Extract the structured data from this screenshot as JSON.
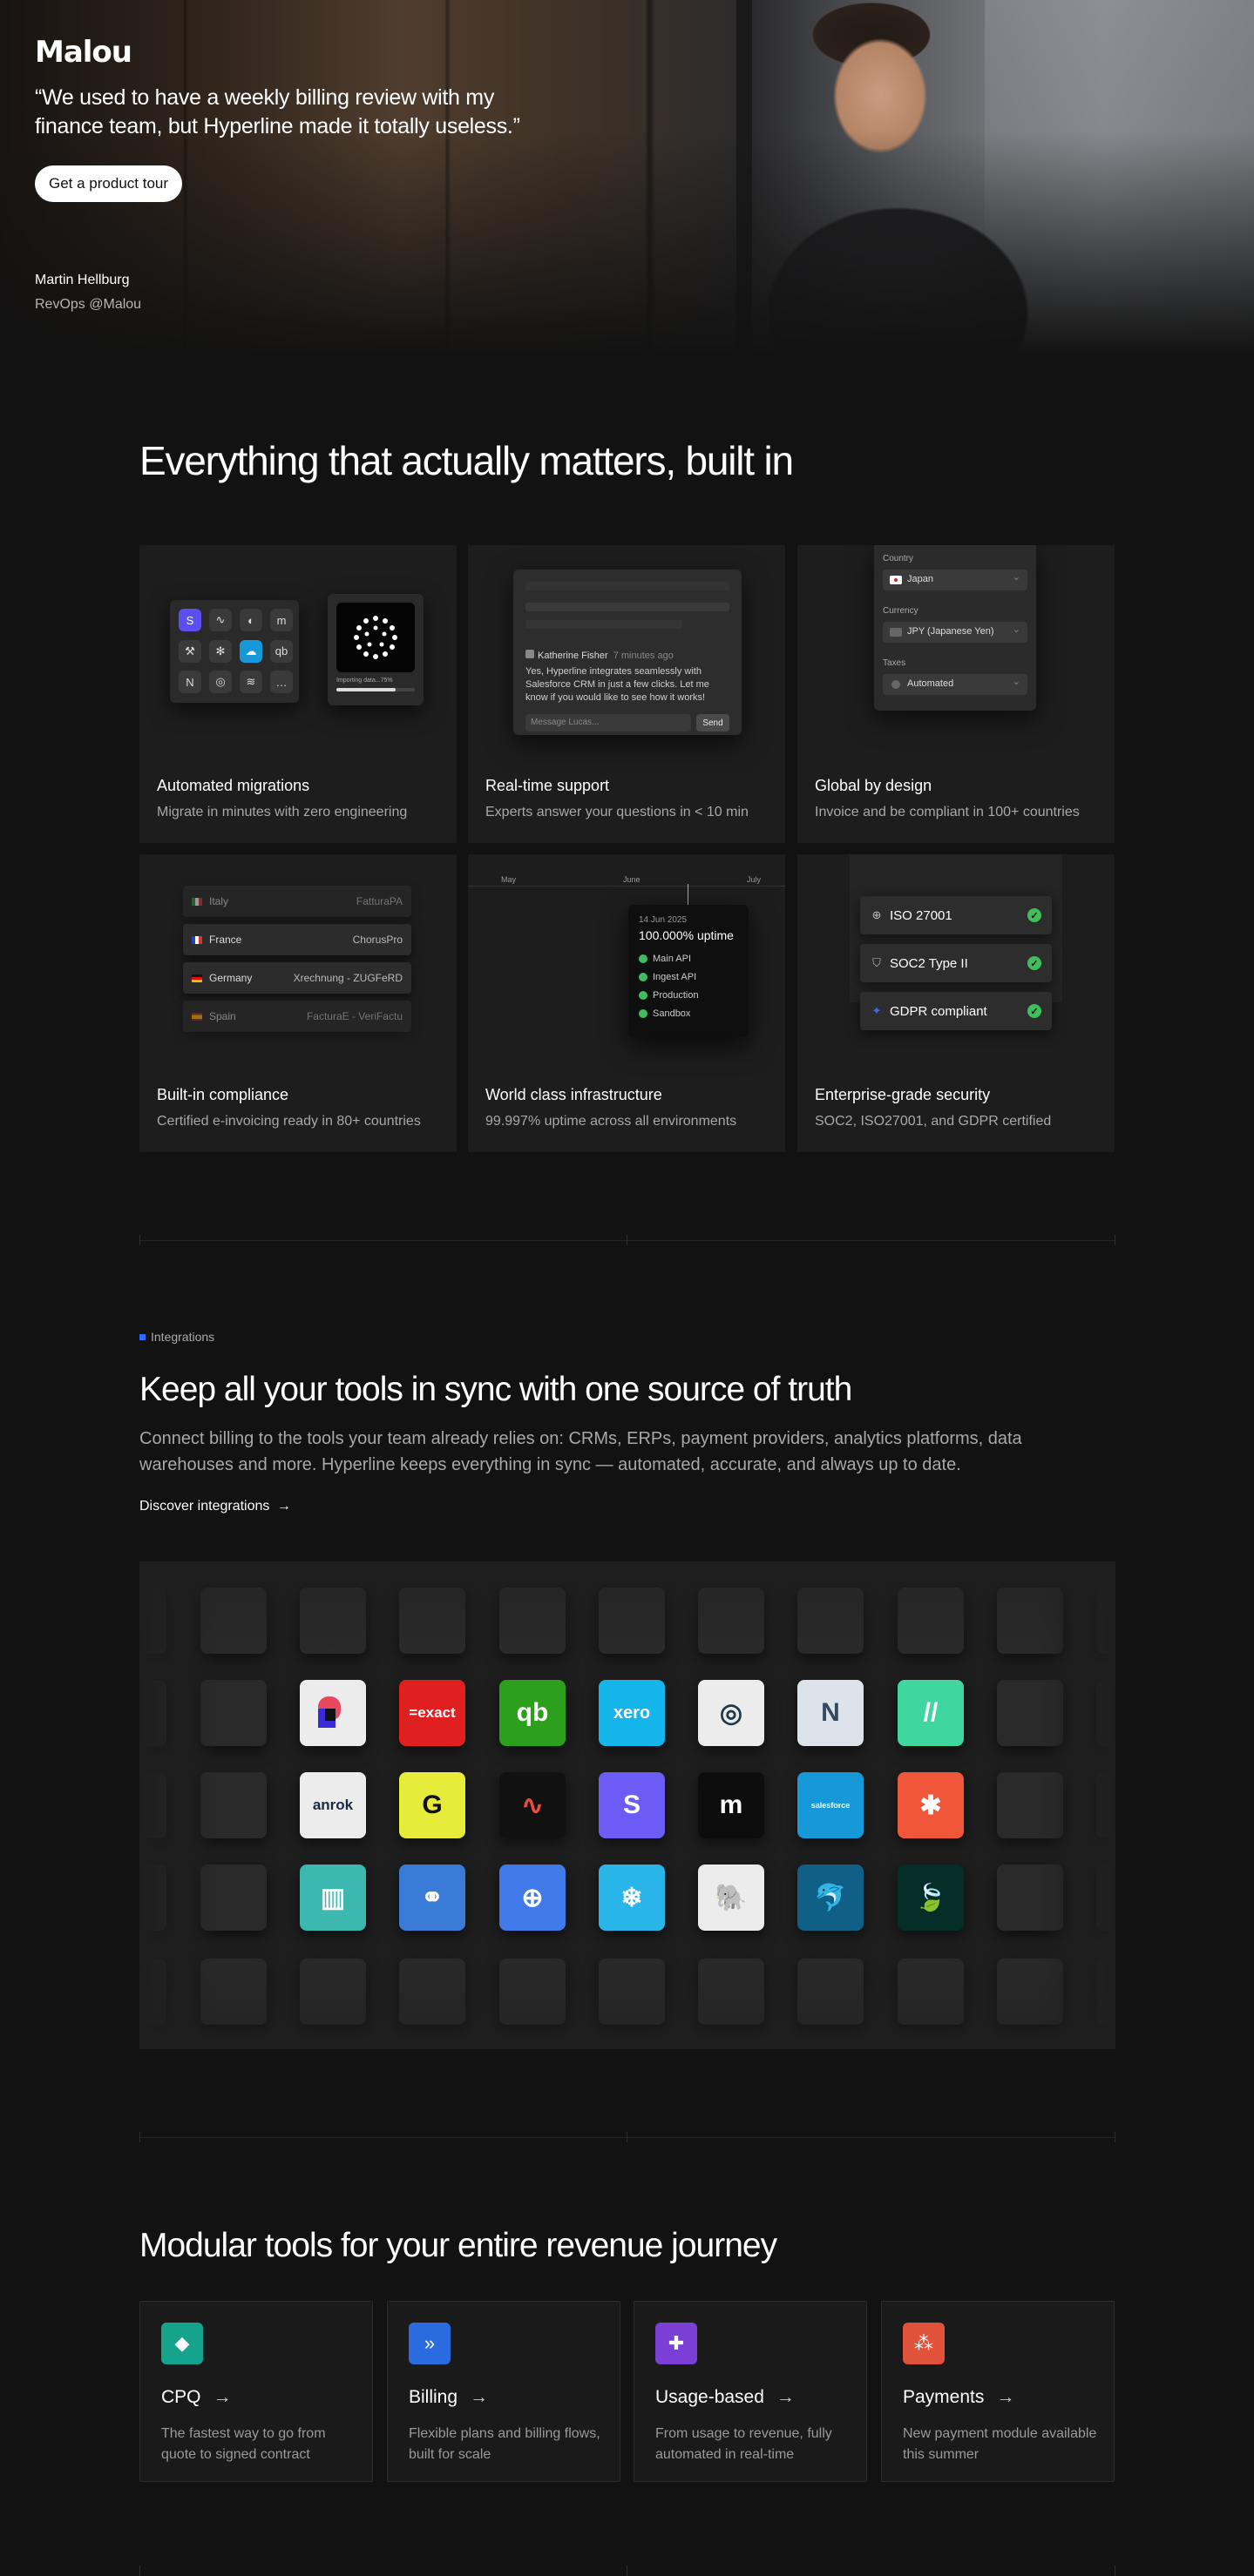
{
  "hero": {
    "logo": "Malou",
    "quote": "“We used to have a weekly billing review with my finance team, but Hyperline made it totally useless.”",
    "cta_label": "Get a product tour",
    "author_name": "Martin Hellburg",
    "author_role": "RevOps @Malou"
  },
  "features": {
    "heading": "Everything that actually matters, built in",
    "cards": [
      {
        "title": "Automated migrations",
        "desc": "Migrate in minutes with zero engineering"
      },
      {
        "title": "Real-time support",
        "desc": "Experts answer your questions in < 10 min"
      },
      {
        "title": "Global by design",
        "desc": "Invoice and be compliant in 100+ countries"
      },
      {
        "title": "Built-in compliance",
        "desc": "Certified e-invoicing ready in 80+ countries"
      },
      {
        "title": "World class infrastructure",
        "desc": "99.997% uptime across all environments"
      },
      {
        "title": "Enterprise-grade security",
        "desc": "SOC2, ISO27001, and GDPR certified"
      }
    ],
    "migration": {
      "progress_label": "Importing data...",
      "progress_pct": "75%",
      "progress_value": 0.75
    },
    "support": {
      "agent": "Katherine Fisher",
      "time": "7 minutes ago",
      "message": "Yes, Hyperline integrates seamlessly with Salesforce CRM in just a few clicks. Let me know if you would like to see how it works!",
      "input_placeholder": "Message Lucas...",
      "send_label": "Send"
    },
    "global": {
      "country_label": "Country",
      "country_value": "Japan",
      "currency_label": "Currency",
      "currency_value": "JPY (Japanese Yen)",
      "taxes_label": "Taxes",
      "taxes_value": "Automated"
    },
    "compliance_rows": [
      {
        "country": "Italy",
        "system": "FatturaPA"
      },
      {
        "country": "France",
        "system": "ChorusPro"
      },
      {
        "country": "Germany",
        "system": "Xrechnung - ZUGFeRD"
      },
      {
        "country": "Spain",
        "system": "FacturaE - VeriFactu"
      }
    ],
    "infra": {
      "months": [
        "May",
        "June",
        "July"
      ],
      "date": "14 Jun 2025",
      "uptime": "100.000% uptime",
      "services": [
        "Main API",
        "Ingest API",
        "Production",
        "Sandbox"
      ],
      "status_color": "#3fbf5c"
    },
    "security": [
      "ISO 27001",
      "SOC2 Type II",
      "GDPR compliant"
    ]
  },
  "integrations": {
    "eyebrow": "Integrations",
    "heading": "Keep all your tools in sync with one source of truth",
    "lead": "Connect billing to the tools your team already relies on: CRMs, ERPs, payment providers, analytics platforms, data warehouses and more. Hyperline keeps everything in sync — automated, accurate, and always up to date.",
    "link_label": "Discover integrations",
    "logos": [
      {
        "name": "pennylane-icon",
        "text": "",
        "bg": "#ececec",
        "fg": "#e8475f"
      },
      {
        "name": "exact-icon",
        "text": "=exact",
        "bg": "#e02020",
        "fg": "#ffffff"
      },
      {
        "name": "quickbooks-icon",
        "text": "qb",
        "bg": "#2ca01c",
        "fg": "#ffffff"
      },
      {
        "name": "xero-icon",
        "text": "xero",
        "bg": "#13b5ea",
        "fg": "#ffffff"
      },
      {
        "name": "circle-logo-icon",
        "text": "◎",
        "bg": "#ececec",
        "fg": "#1e3a4a"
      },
      {
        "name": "netsuite-icon",
        "text": "N",
        "bg": "#dde3ea",
        "fg": "#34495e"
      },
      {
        "name": "vertical-icon",
        "text": "//",
        "bg": "#3fd6a0",
        "fg": "#ffffff"
      },
      {
        "name": "anrok-icon",
        "text": "anrok",
        "bg": "#ececec",
        "fg": "#1b2a44"
      },
      {
        "name": "g-logo-icon",
        "text": "G",
        "bg": "#e7ec3a",
        "fg": "#111111"
      },
      {
        "name": "wave-logo-icon",
        "text": "∿",
        "bg": "#111111",
        "fg": "#ef4b3f"
      },
      {
        "name": "stripe-s-icon",
        "text": "S",
        "bg": "#6b5cf5",
        "fg": "#ffffff"
      },
      {
        "name": "m-logo-icon",
        "text": "m",
        "bg": "#0d0d0d",
        "fg": "#ffffff"
      },
      {
        "name": "salesforce-icon",
        "text": "salesforce",
        "bg": "#1798d8",
        "fg": "#ffffff"
      },
      {
        "name": "hubspot-icon",
        "text": "✱",
        "bg": "#f0573a",
        "fg": "#ffffff"
      },
      {
        "name": "chart-logo-icon",
        "text": "▥",
        "bg": "#3db8b0",
        "fg": "#ffffff"
      },
      {
        "name": "link-logo-icon",
        "text": "⚭",
        "bg": "#3b7bd8",
        "fg": "#ffffff"
      },
      {
        "name": "search-logo-icon",
        "text": "⊕",
        "bg": "#3f7ae8",
        "fg": "#ffffff"
      },
      {
        "name": "snowflake-icon",
        "text": "❄",
        "bg": "#29b5e8",
        "fg": "#ffffff"
      },
      {
        "name": "postgres-icon",
        "text": "🐘",
        "bg": "#ececec",
        "fg": "#336791"
      },
      {
        "name": "mysql-icon",
        "text": "🐬",
        "bg": "#0f5f86",
        "fg": "#ffffff"
      },
      {
        "name": "mongodb-icon",
        "text": "🍃",
        "bg": "#062e29",
        "fg": "#13aa52"
      }
    ]
  },
  "modular": {
    "heading": "Modular tools for your entire revenue journey",
    "tools": [
      {
        "title": "CPQ",
        "desc": "The fastest way to go from quote to signed contract",
        "color": "#16a38d",
        "icon": "◆"
      },
      {
        "title": "Billing",
        "desc": "Flexible plans and billing flows, built for scale",
        "color": "#2a6ce0",
        "icon": "»"
      },
      {
        "title": "Usage-based",
        "desc": "From usage to revenue, fully automated in real-time",
        "color": "#7b3fd6",
        "icon": "✚"
      },
      {
        "title": "Payments",
        "desc": "New payment module available this summer",
        "color": "#e0533a",
        "icon": "⁂"
      }
    ]
  }
}
